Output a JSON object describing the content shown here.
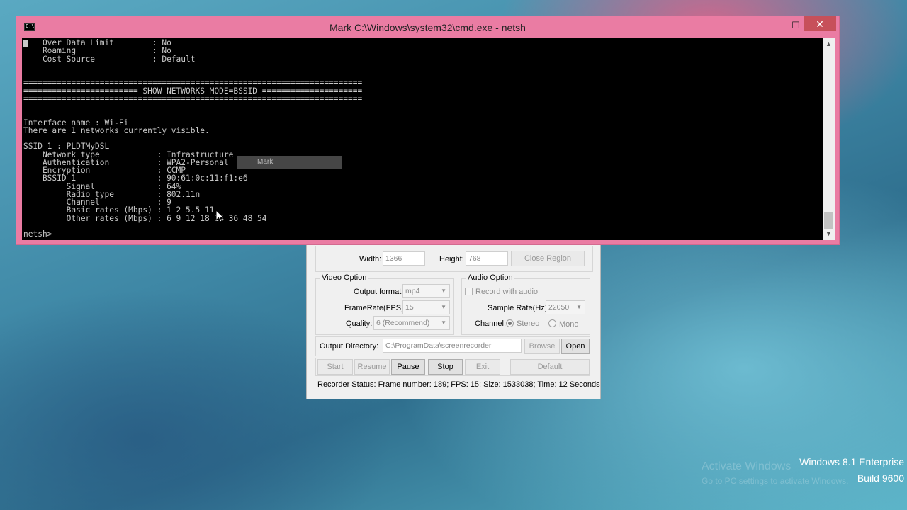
{
  "cmd": {
    "title": "Mark C:\\Windows\\system32\\cmd.exe - netsh",
    "icon_label": "C:\\",
    "minimize": "—",
    "maximize": "☐",
    "close": "✕",
    "console_text": "    Over Data Limit        : No\n    Roaming                : No\n    Cost Source            : Default\n\n\n=======================================================================\n======================== SHOW NETWORKS MODE=BSSID =====================\n=======================================================================\n\n\nInterface name : Wi-Fi\nThere are 1 networks currently visible.\n\nSSID 1 : PLDTMyDSL\n    Network type            : Infrastructure\n    Authentication          : WPA2-Personal\n    Encryption              : CCMP\n    BSSID 1                 : 90:61:0c:11:f1:e6\n         Signal             : 64%\n         Radio type         : 802.11n\n         Channel            : 9\n         Basic rates (Mbps) : 1 2 5.5 11\n         Other rates (Mbps) : 6 9 12 18 24 36 48 54\n\nnetsh>",
    "mark_overlay_label": "Mark"
  },
  "recorder": {
    "width_label": "Width:",
    "width_value": "1366",
    "height_label": "Height:",
    "height_value": "768",
    "close_region": "Close Region",
    "video_group": "Video Option",
    "output_format_label": "Output format:",
    "output_format_value": "mp4",
    "fps_label": "FrameRate(FPS):",
    "fps_value": "15",
    "quality_label": "Quality:",
    "quality_value": "6 (Recommend)",
    "audio_group": "Audio Option",
    "record_audio_label": "Record with audio",
    "sample_rate_label": "Sample Rate(Hz):",
    "sample_rate_value": "22050",
    "channel_label": "Channel:",
    "stereo_label": "Stereo",
    "mono_label": "Mono",
    "output_dir_label": "Output Directory:",
    "output_dir_value": "C:\\ProgramData\\screenrecorder",
    "browse": "Browse",
    "open": "Open",
    "start": "Start",
    "resume": "Resume",
    "pause": "Pause",
    "stop": "Stop",
    "exit": "Exit",
    "default": "Default",
    "status": "Recorder Status: Frame number: 189; FPS: 15; Size: 1533038; Time: 12 Seconds"
  },
  "watermark": {
    "edition": "Windows 8.1 Enterprise",
    "build": "Build 9600",
    "activate_title": "Activate Windows",
    "activate_sub": "Go to PC settings to activate Windows."
  }
}
